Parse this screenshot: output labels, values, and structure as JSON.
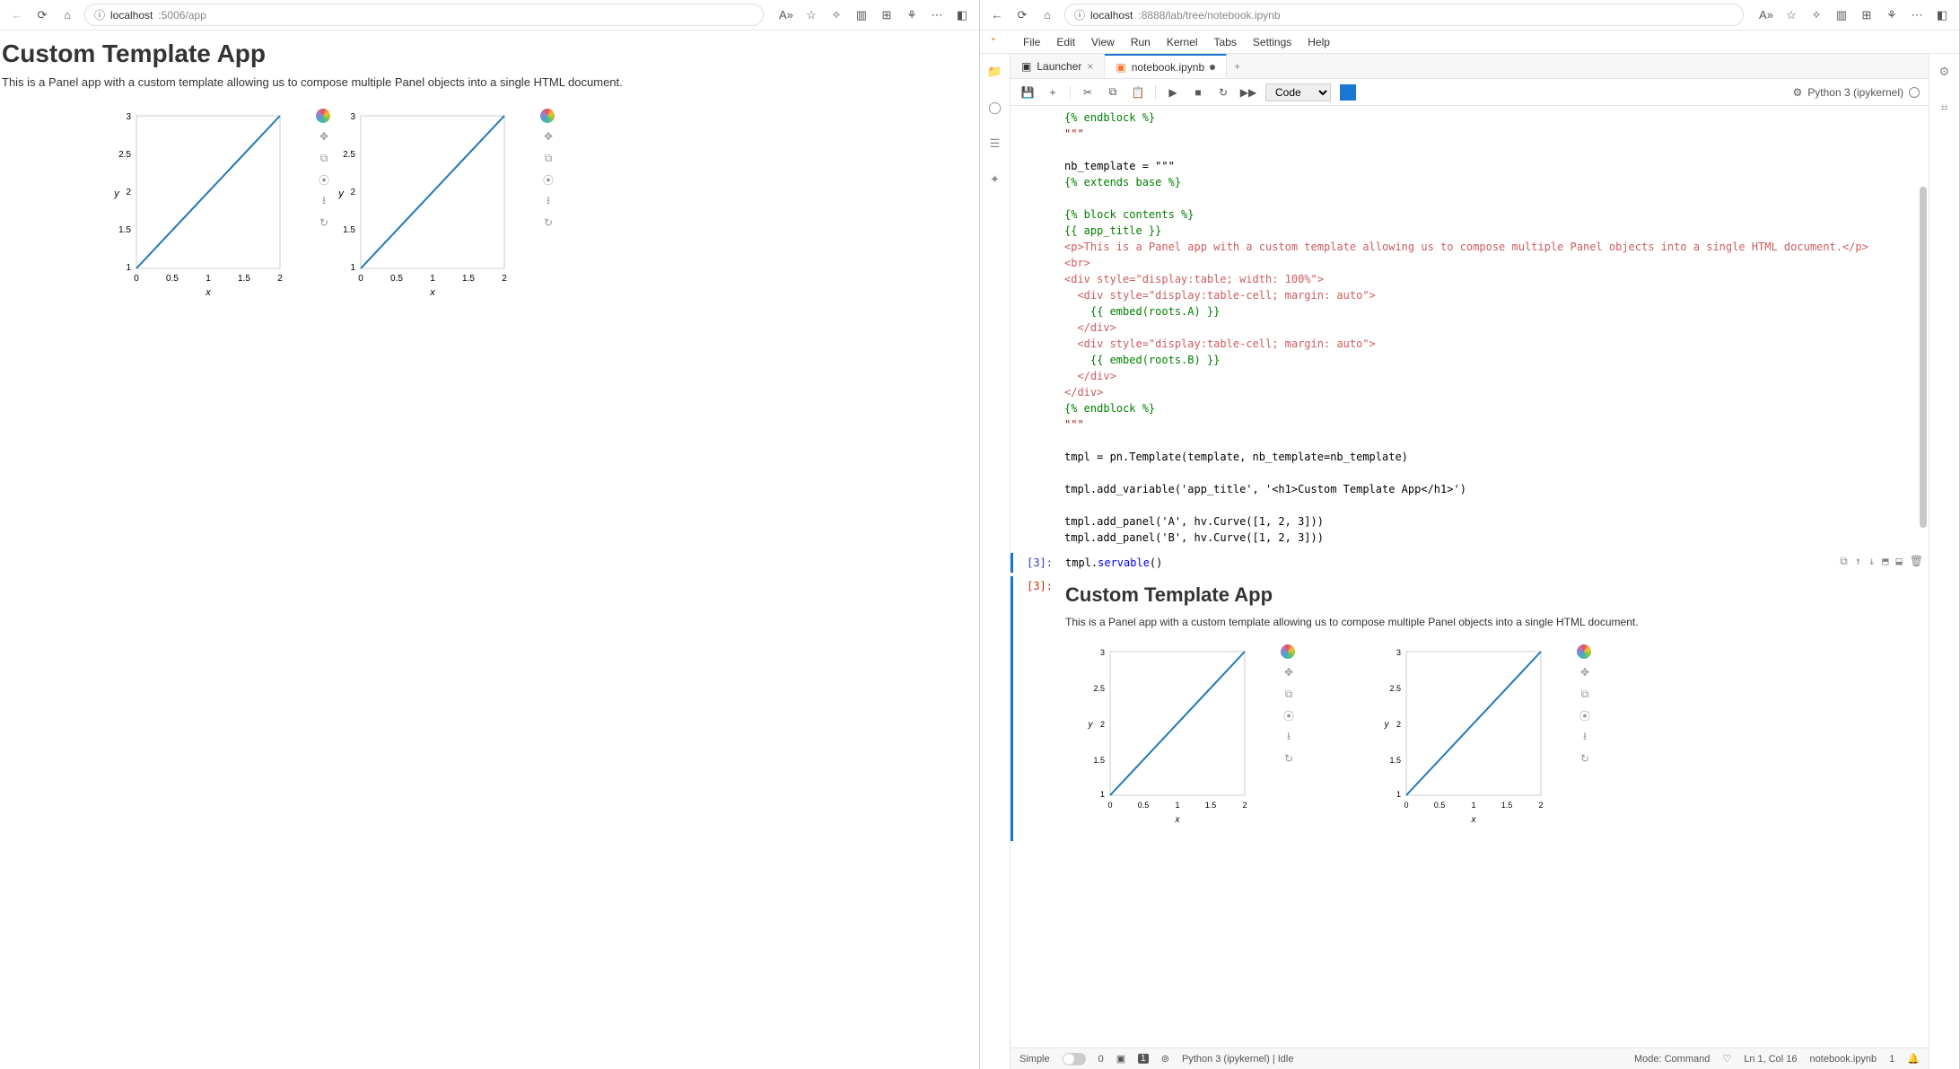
{
  "left": {
    "url_host": "localhost",
    "url_path": ":5006/app",
    "app_title": "Custom Template App",
    "app_desc": "This is a Panel app with a custom template allowing us to compose multiple Panel objects into a single HTML document."
  },
  "right": {
    "url_host": "localhost",
    "url_path": ":8888/lab/tree/notebook.ipynb",
    "menu": [
      "File",
      "Edit",
      "View",
      "Run",
      "Kernel",
      "Tabs",
      "Settings",
      "Help"
    ],
    "tabs": {
      "launcher": "Launcher",
      "nb": "notebook.ipynb"
    },
    "toolbar": {
      "celltype": "Code",
      "kernel_label": "Python 3 (ipykernel)"
    },
    "code_lines": [
      {
        "cls": "green",
        "t": "{% endblock %}"
      },
      {
        "cls": "brown",
        "t": "\"\"\""
      },
      {
        "cls": "",
        "t": ""
      },
      {
        "cls": "black",
        "t": "nb_template = \"\"\""
      },
      {
        "cls": "green",
        "t": "{% extends base %}"
      },
      {
        "cls": "",
        "t": ""
      },
      {
        "cls": "green",
        "t": "{% block contents %}"
      },
      {
        "cls": "green",
        "t": "{{ app_title }}"
      },
      {
        "cls": "dred",
        "t": "<p>This is a Panel app with a custom template allowing us to compose multiple Panel objects into a single HTML document.</p>"
      },
      {
        "cls": "dred",
        "t": "<br>"
      },
      {
        "cls": "dred",
        "t": "<div style=\"display:table; width: 100%\">"
      },
      {
        "cls": "dred",
        "t": "  <div style=\"display:table-cell; margin: auto\">"
      },
      {
        "cls": "green",
        "t": "    {{ embed(roots.A) }}"
      },
      {
        "cls": "dred",
        "t": "  </div>"
      },
      {
        "cls": "dred",
        "t": "  <div style=\"display:table-cell; margin: auto\">"
      },
      {
        "cls": "green",
        "t": "    {{ embed(roots.B) }}"
      },
      {
        "cls": "dred",
        "t": "  </div>"
      },
      {
        "cls": "dred",
        "t": "</div>"
      },
      {
        "cls": "green",
        "t": "{% endblock %}"
      },
      {
        "cls": "brown",
        "t": "\"\"\""
      },
      {
        "cls": "",
        "t": ""
      },
      {
        "cls": "black",
        "t": "tmpl = pn.Template(template, nb_template=nb_template)"
      },
      {
        "cls": "",
        "t": ""
      },
      {
        "cls": "black",
        "t": "tmpl.add_variable('app_title', '<h1>Custom Template App</h1>')"
      },
      {
        "cls": "",
        "t": ""
      },
      {
        "cls": "black",
        "t": "tmpl.add_panel('A', hv.Curve([1, 2, 3]))"
      },
      {
        "cls": "black",
        "t": "tmpl.add_panel('B', hv.Curve([1, 2, 3]))"
      }
    ],
    "cell3_in": "[3]:",
    "cell3_code": "tmpl.servable()",
    "cell3_out": "[3]:",
    "out_title": "Custom Template App",
    "out_desc": "This is a Panel app with a custom template allowing us to compose multiple Panel objects into a single HTML document."
  },
  "status": {
    "simple": "Simple",
    "zero": "0",
    "one_a": "1",
    "kernel": "Python 3 (ipykernel) | Idle",
    "mode": "Mode: Command",
    "lncol": "Ln 1, Col 16",
    "file": "notebook.ipynb",
    "one_b": "1"
  },
  "chart_data": {
    "type": "line",
    "x": [
      0,
      1,
      2
    ],
    "y": [
      1,
      2,
      3
    ],
    "xlabel": "x",
    "ylabel": "y",
    "xticks": [
      0,
      0.5,
      1,
      1.5,
      2
    ],
    "yticks": [
      1,
      1.5,
      2,
      2.5,
      3
    ],
    "xlim": [
      0,
      2
    ],
    "ylim": [
      1,
      3
    ],
    "note": "Same curve rendered four times (two in left pane, two in notebook output)"
  }
}
